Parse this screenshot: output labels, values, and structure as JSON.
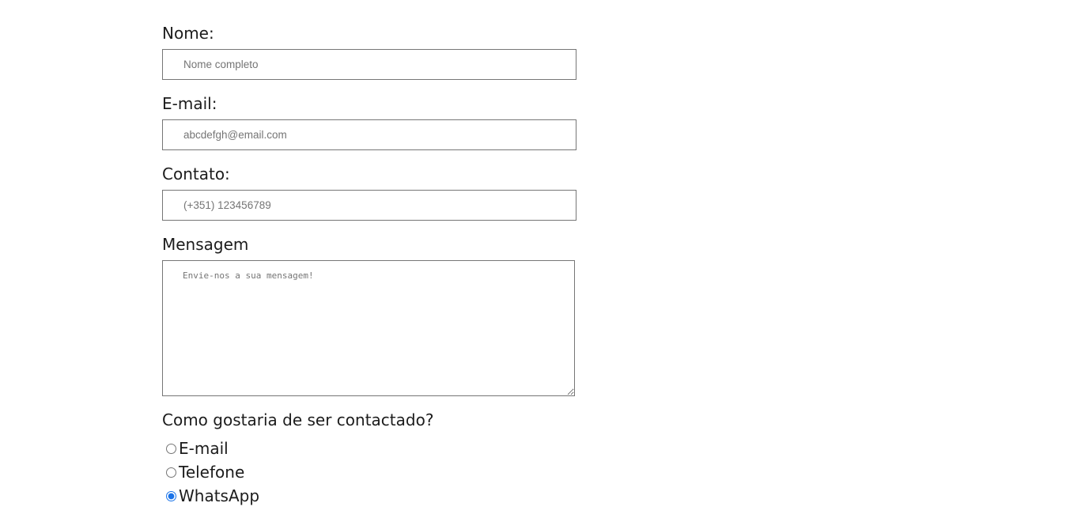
{
  "form": {
    "name_label": "Nome:",
    "name_placeholder": "Nome completo",
    "email_label": "E-mail:",
    "email_placeholder": "abcdefgh@email.com",
    "contact_label": "Contato:",
    "contact_placeholder": "(+351) 123456789",
    "message_label": "Mensagem",
    "message_placeholder": "Envie-nos a sua mensagem!",
    "preference_label": "Como gostaria de ser contactado?",
    "options": [
      {
        "label": "E-mail",
        "checked": false
      },
      {
        "label": "Telefone",
        "checked": false
      },
      {
        "label": "WhatsApp",
        "checked": true
      }
    ],
    "accent_color": "#1a73e8"
  }
}
